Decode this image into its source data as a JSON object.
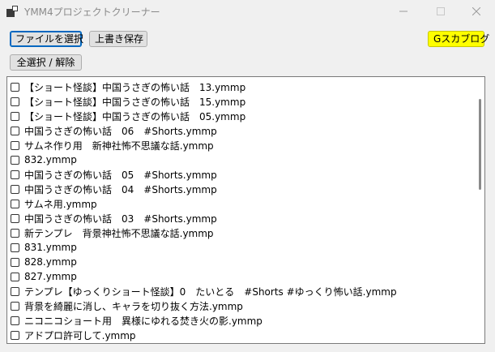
{
  "window": {
    "title": "YMM4プロジェクトクリーナー"
  },
  "toolbar": {
    "select_file": "ファイルを選択",
    "overwrite_save": "上書き保存",
    "select_all_clear": "全選択 / 解除",
    "blog_link": "Gスカブログ"
  },
  "files": [
    "【ショート怪談】中国うさぎの怖い話　13.ymmp",
    "【ショート怪談】中国うさぎの怖い話　15.ymmp",
    "【ショート怪談】中国うさぎの怖い話　05.ymmp",
    "中国うさぎの怖い話　06　#Shorts.ymmp",
    "サムネ作り用　新神社怖不思議な話.ymmp",
    "832.ymmp",
    "中国うさぎの怖い話　05　#Shorts.ymmp",
    "中国うさぎの怖い話　04　#Shorts.ymmp",
    "サムネ用.ymmp",
    "中国うさぎの怖い話　03　#Shorts.ymmp",
    "新テンプレ　背景神社怖不思議な話.ymmp",
    "831.ymmp",
    "828.ymmp",
    "827.ymmp",
    "テンプレ【ゆっくりショート怪談】0　たいとる　#Shorts #ゆっくり怖い話.ymmp",
    "背景を綺麗に消し、キャラを切り抜く方法.ymmp",
    "ニコニコショート用　異様にゆれる焚き火の影.ymmp",
    "アドプロ許可して.ymmp"
  ]
}
